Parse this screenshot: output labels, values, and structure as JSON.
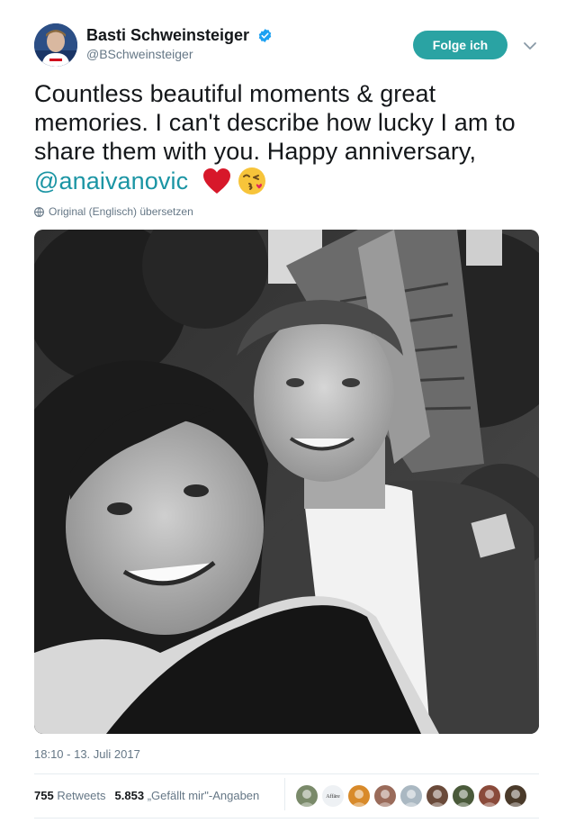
{
  "author": {
    "display_name": "Basti Schweinsteiger",
    "handle": "@BSchweinsteiger",
    "verified_icon": "verified-badge-icon"
  },
  "follow_button": {
    "label": "Folge ich"
  },
  "tweet": {
    "text": "Countless beautiful moments & great memories. I can't describe how lucky I am to share them with you. Happy anniversary,",
    "mention": "@anaivanovic",
    "emojis": [
      "red-heart-icon",
      "face-blowing-kiss-icon"
    ]
  },
  "translate": {
    "label": "Original (Englisch) übersetzen"
  },
  "timestamp": "18:10 - 13. Juli 2017",
  "stats": {
    "retweets_count": "755",
    "retweets_label": "Retweets",
    "likes_count": "5.853",
    "likes_label": "„Gefällt mir\"-Angaben"
  },
  "liker_avatars": [
    {
      "name": "liker-avatar-1",
      "color": "#7a8a6a"
    },
    {
      "name": "liker-avatar-2",
      "color": "#eef1f4",
      "text": "Affäre"
    },
    {
      "name": "liker-avatar-3",
      "color": "#d88a2a"
    },
    {
      "name": "liker-avatar-4",
      "color": "#9a6b5a"
    },
    {
      "name": "liker-avatar-5",
      "color": "#aab8c2"
    },
    {
      "name": "liker-avatar-6",
      "color": "#6a4a3a"
    },
    {
      "name": "liker-avatar-7",
      "color": "#4a5a3a"
    },
    {
      "name": "liker-avatar-8",
      "color": "#8a4a3a"
    },
    {
      "name": "liker-avatar-9",
      "color": "#4a3a2a"
    }
  ],
  "colors": {
    "accent": "#1b95a4",
    "follow_bg": "#2aa3a3",
    "verified": "#1da1f2",
    "muted": "#657786"
  }
}
